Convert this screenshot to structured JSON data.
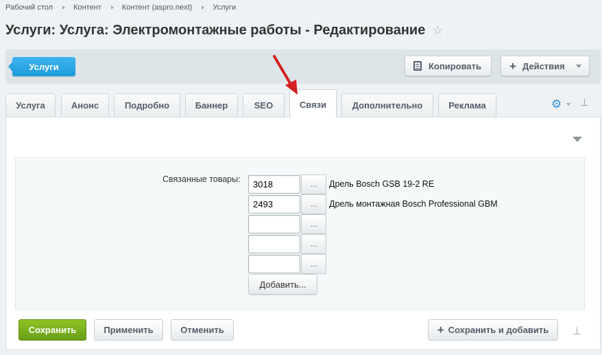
{
  "breadcrumb": [
    "Рабочий стол",
    "Контент",
    "Контент (aspro.next)",
    "Услуги"
  ],
  "page": {
    "title": "Услуги: Услуга: Электромонтажные работы - Редактирование"
  },
  "toolbar": {
    "back_label": "Услуги",
    "copy_label": "Копировать",
    "actions_label": "Действия"
  },
  "tabs": [
    "Услуга",
    "Анонс",
    "Подробно",
    "Баннер",
    "SEO",
    "Связи",
    "Дополнительно",
    "Реклама"
  ],
  "active_tab": "Связи",
  "form": {
    "label": "Связанные товары:",
    "rows": [
      {
        "value": "3018",
        "name": "Дрель Bosch GSB 19-2 RE"
      },
      {
        "value": "2493",
        "name": "Дрель монтажная Bosch Professional GBM"
      },
      {
        "value": "",
        "name": ""
      },
      {
        "value": "",
        "name": ""
      },
      {
        "value": "",
        "name": ""
      }
    ],
    "browse_label": "...",
    "add_label": "Добавить..."
  },
  "footer": {
    "save": "Сохранить",
    "apply": "Применить",
    "cancel": "Отменить",
    "save_add": "Сохранить и добавить"
  },
  "colors": {
    "accent": "#1d9ddb",
    "save": "#77ae1c",
    "arrow": "#d31f1f"
  },
  "icons": [
    "star-icon",
    "copy-icon",
    "plus-icon",
    "chevron-down-icon",
    "gear-icon",
    "pin-icon",
    "collapse-icon",
    "arrow-annotation"
  ]
}
